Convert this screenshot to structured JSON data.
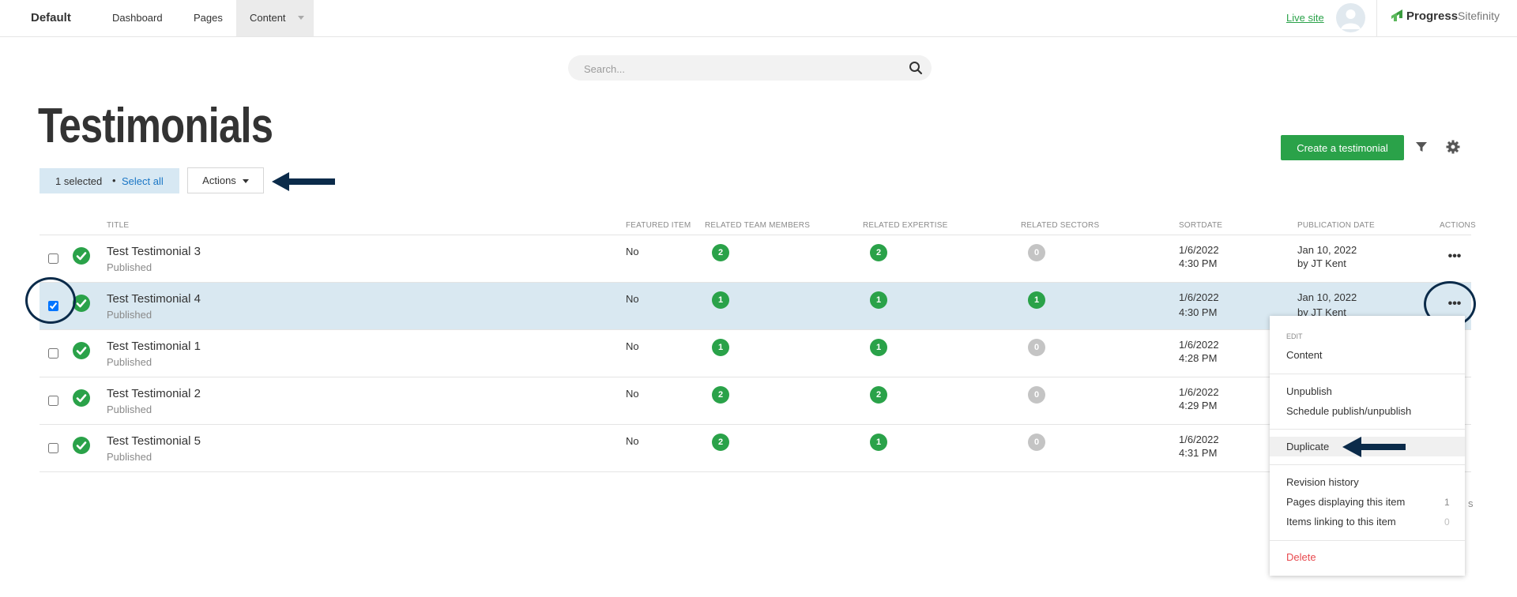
{
  "topbar": {
    "site_name": "Default",
    "nav": [
      "Dashboard",
      "Pages",
      "Content"
    ],
    "live_site": "Live site",
    "brand_name": "Progress",
    "brand_sub": "Sitefinity"
  },
  "search": {
    "placeholder": "Search..."
  },
  "page": {
    "title": "Testimonials",
    "create_button": "Create a testimonial"
  },
  "selection": {
    "count_label": "1 selected",
    "bullet": "•",
    "select_all": "Select all",
    "actions_label": "Actions"
  },
  "table": {
    "headers": [
      "TITLE",
      "FEATURED ITEM",
      "RELATED TEAM MEMBERS",
      "RELATED EXPERTISE",
      "RELATED SECTORS",
      "SORTDATE",
      "PUBLICATION DATE",
      "ACTIONS"
    ],
    "rows": [
      {
        "title": "Test Testimonial 3",
        "status": "Published",
        "featured": "No",
        "team": "2",
        "expertise": "2",
        "sectors": "0",
        "sort_date": "1/6/2022",
        "sort_time": "4:30 PM",
        "pub_date": "Jan 10, 2022",
        "pub_by": "by JT Kent",
        "checked": false
      },
      {
        "title": "Test Testimonial 4",
        "status": "Published",
        "featured": "No",
        "team": "1",
        "expertise": "1",
        "sectors": "1",
        "sort_date": "1/6/2022",
        "sort_time": "4:30 PM",
        "pub_date": "Jan 10, 2022",
        "pub_by": "by JT Kent",
        "checked": true
      },
      {
        "title": "Test Testimonial 1",
        "status": "Published",
        "featured": "No",
        "team": "1",
        "expertise": "1",
        "sectors": "0",
        "sort_date": "1/6/2022",
        "sort_time": "4:28 PM",
        "pub_date": "",
        "pub_by": "",
        "checked": false
      },
      {
        "title": "Test Testimonial 2",
        "status": "Published",
        "featured": "No",
        "team": "2",
        "expertise": "2",
        "sectors": "0",
        "sort_date": "1/6/2022",
        "sort_time": "4:29 PM",
        "pub_date": "",
        "pub_by": "",
        "checked": false
      },
      {
        "title": "Test Testimonial 5",
        "status": "Published",
        "featured": "No",
        "team": "2",
        "expertise": "1",
        "sectors": "0",
        "sort_date": "1/6/2022",
        "sort_time": "4:31 PM",
        "pub_date": "",
        "pub_by": "",
        "checked": false
      }
    ],
    "more_label": "•••",
    "pager_fragment": "s"
  },
  "menu": {
    "section_header": "EDIT",
    "content": "Content",
    "unpublish": "Unpublish",
    "schedule": "Schedule publish/unpublish",
    "duplicate": "Duplicate",
    "revision_history": "Revision history",
    "pages_displaying": "Pages displaying this item",
    "pages_displaying_count": "1",
    "items_linking": "Items linking to this item",
    "items_linking_count": "0",
    "delete": "Delete"
  },
  "colors": {
    "accent_green": "#2aa249",
    "selected_row": "#d9e8f1",
    "link_blue": "#1a76c5",
    "delete_red": "#e8494e",
    "annotation_navy": "#0b2b4a"
  }
}
